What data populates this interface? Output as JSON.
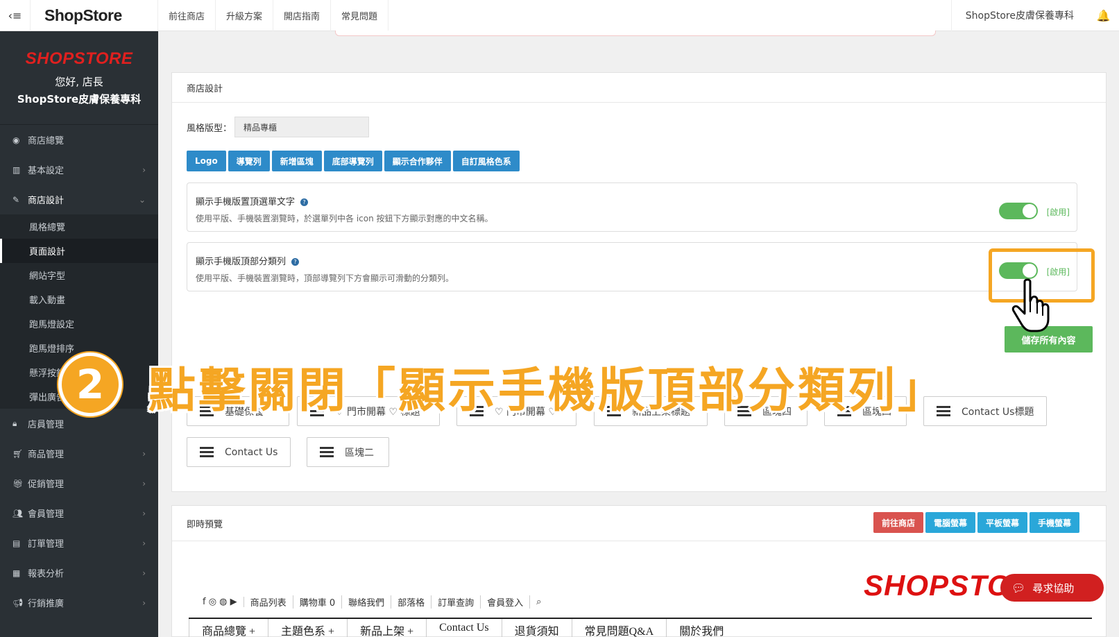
{
  "topbar": {
    "logo": "ShopStore",
    "nav": [
      "前往商店",
      "升級方案",
      "開店指南",
      "常見問題"
    ],
    "store_name": "ShopStore皮膚保養專科"
  },
  "sidebar": {
    "brand_logo": "SHOPSTORE",
    "greeting": "您好, 店長",
    "store_name": "ShopStore皮膚保養專科",
    "items_top": [
      {
        "label": "商店總覽",
        "icon": "dashboard-icon",
        "arrow": ""
      },
      {
        "label": "基本設定",
        "icon": "bank-icon",
        "arrow": "›"
      },
      {
        "label": "商店設計",
        "icon": "brush-icon",
        "arrow": "⌄"
      }
    ],
    "subitems": [
      "風格總覽",
      "頁面設計",
      "網站字型",
      "載入動畫",
      "跑馬燈設定",
      "跑馬燈排序",
      "懸浮按鈕",
      "彈出廣告"
    ],
    "items_bottom": [
      {
        "label": "店員管理",
        "icon": "lock-icon",
        "arrow": ""
      },
      {
        "label": "商品管理",
        "icon": "cart-icon",
        "arrow": "›"
      },
      {
        "label": "促銷管理",
        "icon": "gift-icon",
        "arrow": "›"
      },
      {
        "label": "會員管理",
        "icon": "users-icon",
        "arrow": "›"
      },
      {
        "label": "訂單管理",
        "icon": "orders-icon",
        "arrow": "›"
      },
      {
        "label": "報表分析",
        "icon": "chart-icon",
        "arrow": "›"
      },
      {
        "label": "行銷推廣",
        "icon": "megaphone-icon",
        "arrow": "›"
      }
    ]
  },
  "design": {
    "title": "商店設計",
    "style_label": "風格版型：",
    "style_value": "精品專櫃",
    "tabs": [
      "Logo",
      "導覽列",
      "新增區塊",
      "底部導覽列",
      "顯示合作夥伴",
      "自訂風格色系"
    ],
    "setting1": {
      "title": "顯示手機版置頂選單文字",
      "desc": "使用平版、手機裝置瀏覽時，於選單列中各 icon 按鈕下方顯示對應的中文名稱。",
      "state": "[啟用]"
    },
    "setting2": {
      "title": "顯示手機版頂部分類列",
      "desc": "使用平版、手機裝置瀏覽時，頂部導覽列下方會顯示可滑動的分類列。",
      "state": "[啟用]"
    },
    "save": "儲存所有內容",
    "chips_row1": [
      "基礎保養",
      "♡ 門市開幕 ♡ 標題",
      "♡ 門市開幕 ♡",
      "新品上架標題",
      "區塊四",
      "區塊四",
      "Contact Us標題"
    ],
    "chips_row2": [
      "Contact Us",
      "區塊二"
    ]
  },
  "overlay": {
    "step": "2",
    "text": "點擊關閉「顯示手機版頂部分類列」"
  },
  "preview": {
    "title": "即時預覽",
    "buttons": [
      {
        "label": "前往商店",
        "color": "#d9534f"
      },
      {
        "label": "電腦螢幕",
        "color": "#2aa7d9"
      },
      {
        "label": "平板螢幕",
        "color": "#2aa7d9"
      },
      {
        "label": "手機螢幕",
        "color": "#2aa7d9"
      }
    ],
    "logo": "SHOPSTORE",
    "nav": [
      "商品列表",
      "購物車 0",
      "聯絡我們",
      "部落格",
      "訂單查詢",
      "會員登入"
    ],
    "menu": [
      "商品總覽 +",
      "主題色系 +",
      "新品上架 +",
      "Contact Us",
      "退貨須知",
      "常見問題Q&A",
      "關於我們"
    ],
    "help": "尋求協助"
  }
}
